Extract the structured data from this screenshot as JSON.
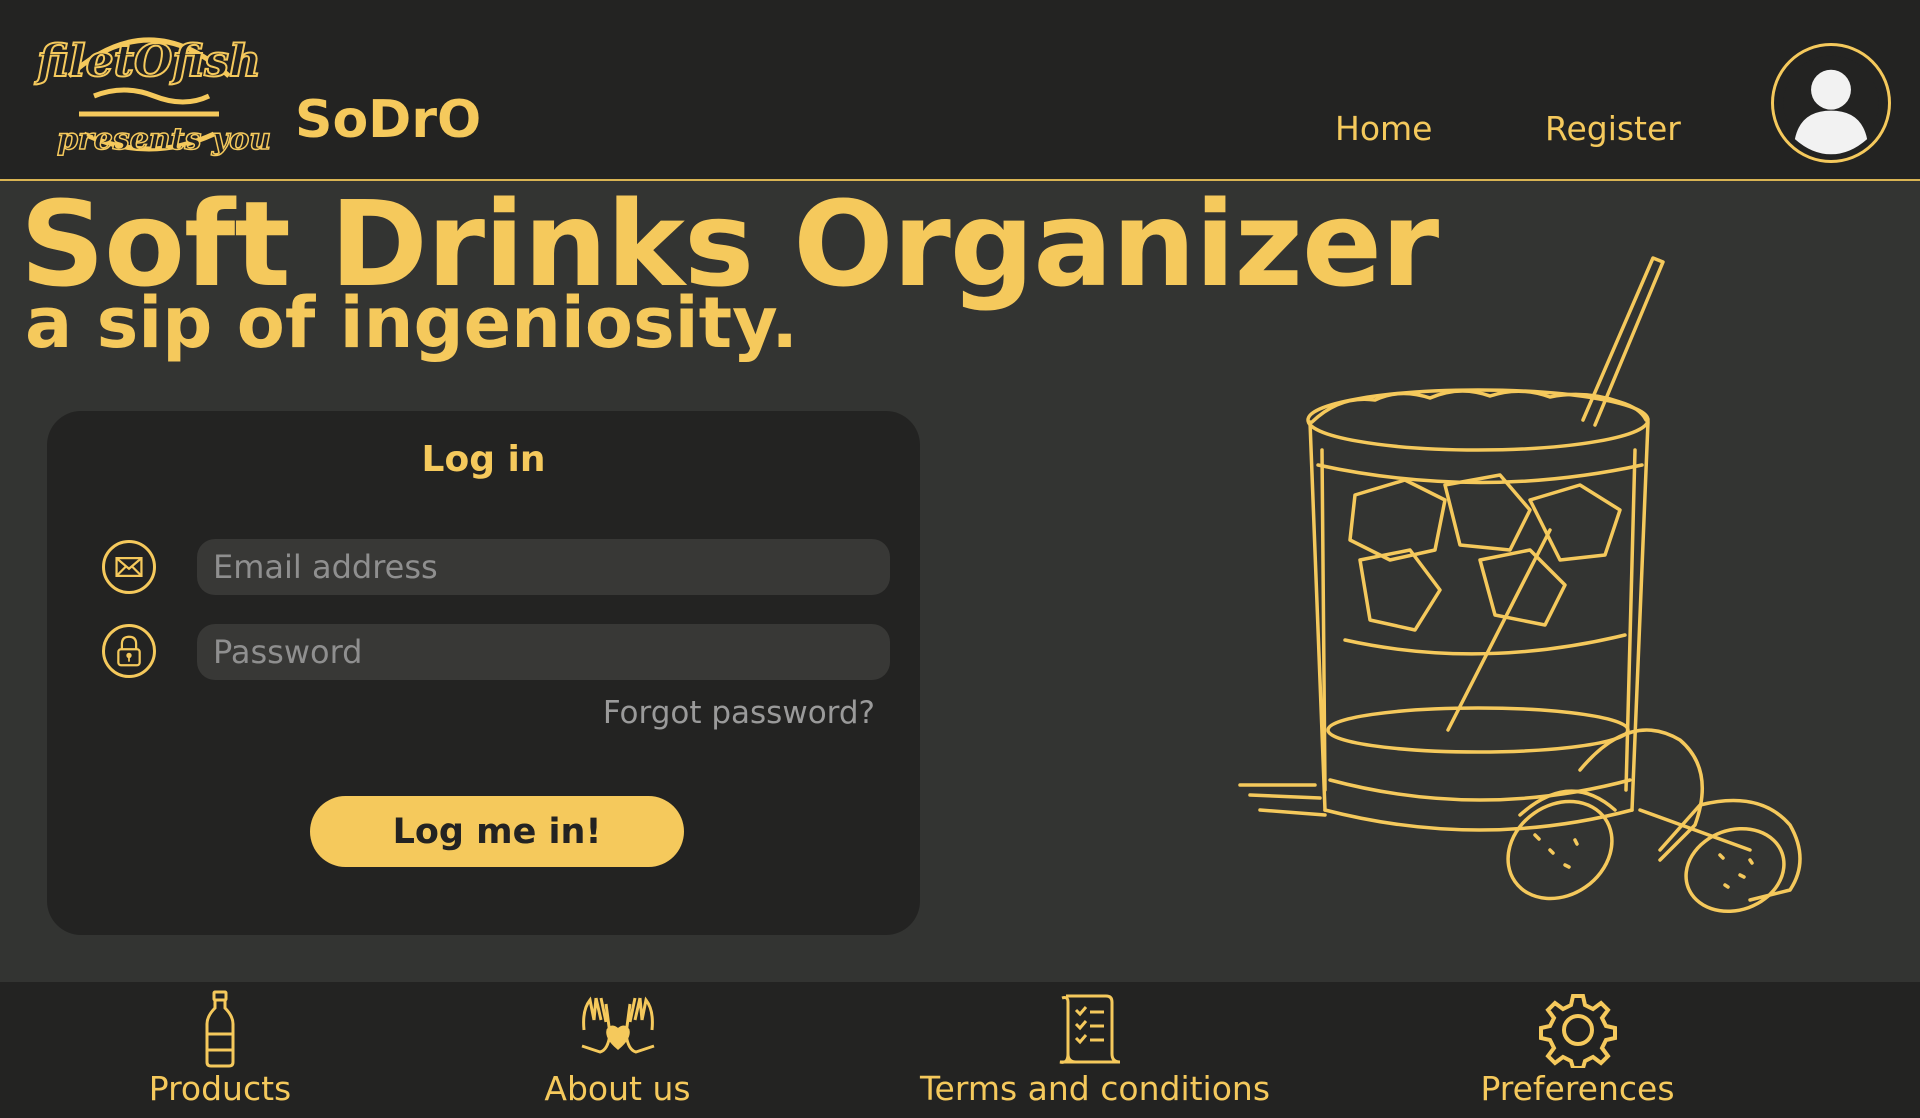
{
  "header": {
    "logo_text_top": "filetOfish",
    "logo_text_bottom": "presents you",
    "brand": "SoDrO",
    "nav": [
      {
        "label": "Home"
      },
      {
        "label": "Register"
      }
    ],
    "avatar_icon": "user-avatar-icon"
  },
  "hero": {
    "title": "Soft Drinks Organizer",
    "subtitle": "a sip of ingeniosity."
  },
  "login": {
    "title": "Log in",
    "email_placeholder": "Email address",
    "password_placeholder": "Password",
    "forgot": "Forgot password?",
    "submit": "Log me in!"
  },
  "footer": {
    "items": [
      {
        "label": "Products",
        "icon": "bottle-icon"
      },
      {
        "label": "About us",
        "icon": "heart-hands-icon"
      },
      {
        "label": "Terms and conditions",
        "icon": "scroll-checklist-icon"
      },
      {
        "label": "Preferences",
        "icon": "gear-icon"
      }
    ]
  },
  "colors": {
    "accent": "#f5c95c",
    "bar_background": "#232322",
    "page_background": "#333432"
  }
}
